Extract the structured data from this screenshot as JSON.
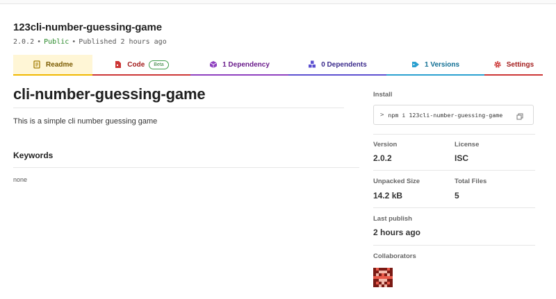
{
  "package": {
    "name": "123cli-number-guessing-game",
    "version": "2.0.2",
    "visibility": "Public",
    "published": "Published 2 hours ago",
    "separator": "•"
  },
  "tabs": {
    "readme": "Readme",
    "code": "Code",
    "code_badge": "Beta",
    "dependencies": "1 Dependency",
    "dependents": "0 Dependents",
    "versions": "1 Versions",
    "settings": "Settings"
  },
  "readme": {
    "title": "cli-number-guessing-game",
    "description": "This is a simple cli number guessing game",
    "keywords_heading": "Keywords",
    "keywords_value": "none"
  },
  "sidebar": {
    "install_label": "Install",
    "install_prompt": ">",
    "install_command": "npm i 123cli-number-guessing-game",
    "version_label": "Version",
    "version_value": "2.0.2",
    "license_label": "License",
    "license_value": "ISC",
    "unpacked_label": "Unpacked Size",
    "unpacked_value": "14.2 kB",
    "total_files_label": "Total Files",
    "total_files_value": "5",
    "last_publish_label": "Last publish",
    "last_publish_value": "2 hours ago",
    "collaborators_label": "Collaborators"
  },
  "icons": {
    "readme": "document-icon",
    "code": "file-code-icon",
    "dependencies": "cube-icon",
    "dependents": "cubes-icon",
    "versions": "tag-icon",
    "settings": "gear-icon",
    "copy": "copy-icon",
    "avatar": "collaborator-avatar"
  },
  "colors": {
    "readme": "#f0b800",
    "code": "#cc3534",
    "dependencies": "#8e3fbf",
    "dependents": "#5b4fd0",
    "versions": "#2aa0d0",
    "settings": "#cc3534"
  }
}
